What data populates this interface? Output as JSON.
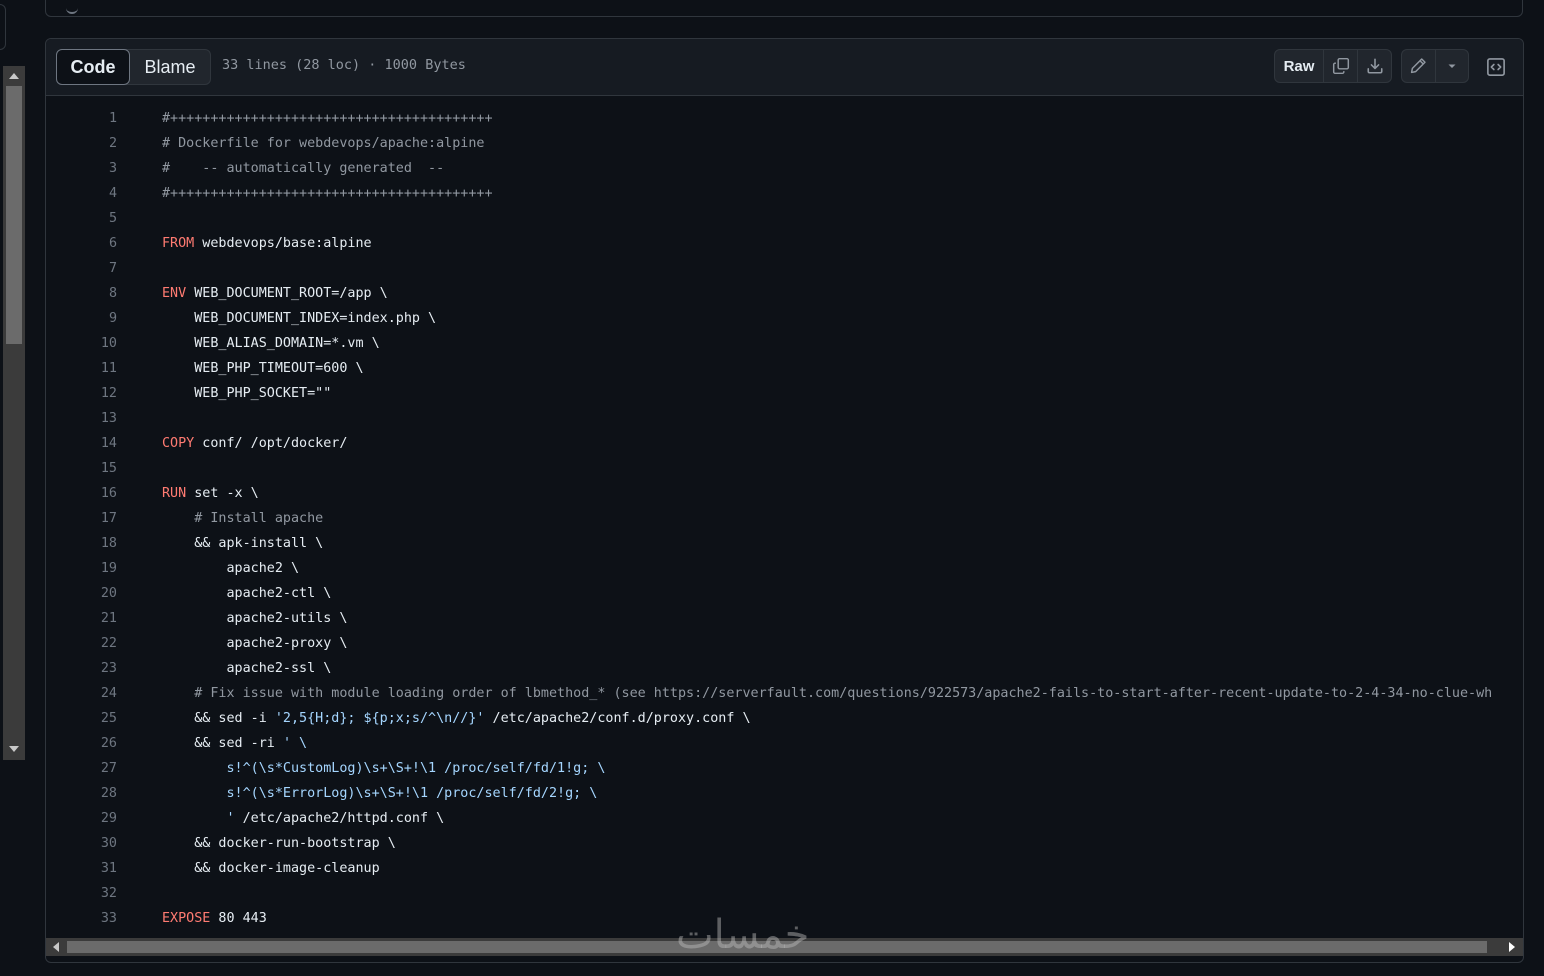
{
  "tabs": {
    "code": "Code",
    "blame": "Blame"
  },
  "file_meta": "33 lines (28 loc) · 1000 Bytes",
  "toolbar": {
    "raw": "Raw"
  },
  "icons": {
    "copy": "copy-icon",
    "download": "download-icon",
    "edit": "pencil-icon",
    "dropdown": "triangle-down-icon",
    "symbols": "code-square-icon"
  },
  "colors": {
    "keyword": "#ff7b72",
    "string": "#a5d6ff",
    "comment": "#9198a1",
    "text": "#e6edf3",
    "line_number": "#6e7681"
  },
  "watermark": "خمسات",
  "code_lines": [
    [
      {
        "t": "#++++++++++++++++++++++++++++++++++++++++",
        "c": "c"
      }
    ],
    [
      {
        "t": "# Dockerfile for webdevops/apache:alpine",
        "c": "c"
      }
    ],
    [
      {
        "t": "#    -- automatically generated  --",
        "c": "c"
      }
    ],
    [
      {
        "t": "#++++++++++++++++++++++++++++++++++++++++",
        "c": "c"
      }
    ],
    [],
    [
      {
        "t": "FROM",
        "c": "kw"
      },
      {
        "t": " webdevops/base:alpine",
        "c": ""
      }
    ],
    [],
    [
      {
        "t": "ENV",
        "c": "kw"
      },
      {
        "t": " WEB_DOCUMENT_ROOT=/app \\",
        "c": ""
      }
    ],
    [
      {
        "t": "    WEB_DOCUMENT_INDEX=index.php \\",
        "c": ""
      }
    ],
    [
      {
        "t": "    WEB_ALIAS_DOMAIN=*.vm \\",
        "c": ""
      }
    ],
    [
      {
        "t": "    WEB_PHP_TIMEOUT=600 \\",
        "c": ""
      }
    ],
    [
      {
        "t": "    WEB_PHP_SOCKET=\"\"",
        "c": ""
      }
    ],
    [],
    [
      {
        "t": "COPY",
        "c": "kw"
      },
      {
        "t": " conf/ /opt/docker/",
        "c": ""
      }
    ],
    [],
    [
      {
        "t": "RUN",
        "c": "kw"
      },
      {
        "t": " set -x \\",
        "c": ""
      }
    ],
    [
      {
        "t": "    ",
        "c": ""
      },
      {
        "t": "# Install apache",
        "c": "c"
      }
    ],
    [
      {
        "t": "    && apk-install \\",
        "c": ""
      }
    ],
    [
      {
        "t": "        apache2 \\",
        "c": ""
      }
    ],
    [
      {
        "t": "        apache2-ctl \\",
        "c": ""
      }
    ],
    [
      {
        "t": "        apache2-utils \\",
        "c": ""
      }
    ],
    [
      {
        "t": "        apache2-proxy \\",
        "c": ""
      }
    ],
    [
      {
        "t": "        apache2-ssl \\",
        "c": ""
      }
    ],
    [
      {
        "t": "    ",
        "c": ""
      },
      {
        "t": "# Fix issue with module loading order of lbmethod_* (see https://serverfault.com/questions/922573/apache2-fails-to-start-after-recent-update-to-2-4-34-no-clue-wh",
        "c": "c"
      }
    ],
    [
      {
        "t": "    && sed -i ",
        "c": ""
      },
      {
        "t": "'2,5{H;d}; ${p;x;s/^\\n//}'",
        "c": "s"
      },
      {
        "t": " /etc/apache2/conf.d/proxy.conf \\",
        "c": ""
      }
    ],
    [
      {
        "t": "    && sed -ri ",
        "c": ""
      },
      {
        "t": "' \\",
        "c": "s"
      }
    ],
    [
      {
        "t": "        s!^(\\s*CustomLog)\\s+\\S+!\\1 /proc/self/fd/1!g; \\",
        "c": "s"
      }
    ],
    [
      {
        "t": "        s!^(\\s*ErrorLog)\\s+\\S+!\\1 /proc/self/fd/2!g; \\",
        "c": "s"
      }
    ],
    [
      {
        "t": "        '",
        "c": "s"
      },
      {
        "t": " /etc/apache2/httpd.conf \\",
        "c": ""
      }
    ],
    [
      {
        "t": "    && docker-run-bootstrap \\",
        "c": ""
      }
    ],
    [
      {
        "t": "    && docker-image-cleanup",
        "c": ""
      }
    ],
    [],
    [
      {
        "t": "EXPOSE",
        "c": "kw"
      },
      {
        "t": " 80 443",
        "c": ""
      }
    ]
  ]
}
